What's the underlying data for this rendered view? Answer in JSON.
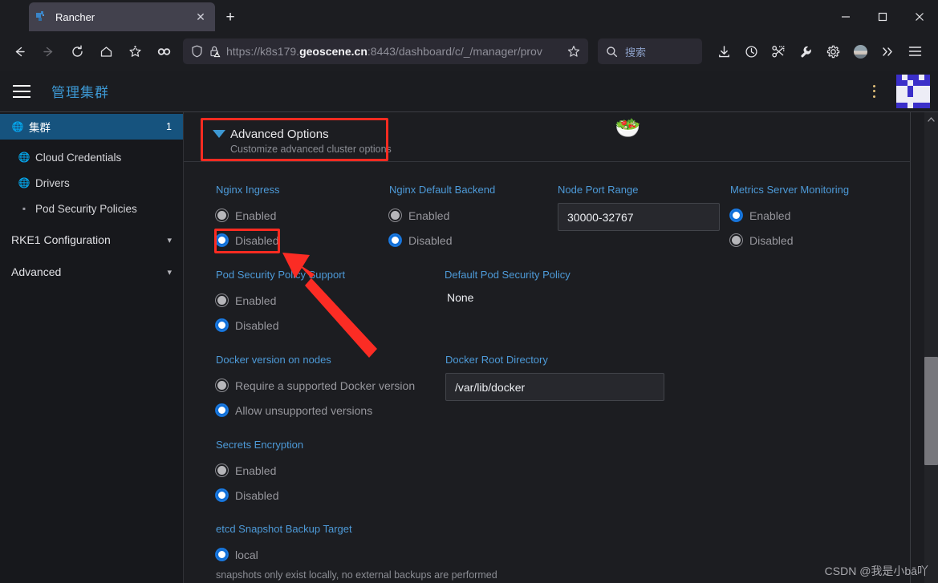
{
  "browser": {
    "tab": {
      "title": "Rancher",
      "favicon_icon": "rancher-logo-icon",
      "close_icon": "close-icon"
    },
    "newtab_icon": "plus-icon",
    "window_controls": {
      "minimize": "minimize-icon",
      "maximize": "maximize-icon",
      "close": "close-icon"
    },
    "nav": {
      "back_icon": "back-arrow-icon",
      "forward_icon": "forward-arrow-icon",
      "reload_icon": "reload-icon",
      "home_icon": "home-icon",
      "bookmark_icon": "bookmark-add-icon",
      "pocket_icon": "pocket-icon"
    },
    "url": {
      "shield_icon": "shield-icon",
      "lock_icon": "lock-warning-icon",
      "prefix": "https://k8s179.",
      "host_bold": "geoscene.cn",
      "suffix": ":8443/dashboard/c/_/manager/prov",
      "star_icon": "star-icon"
    },
    "search": {
      "icon": "search-icon",
      "placeholder": "搜索"
    },
    "toolbar": [
      {
        "name": "downloads-icon"
      },
      {
        "name": "history-icon"
      },
      {
        "name": "screenshot-icon"
      },
      {
        "name": "wrench-icon"
      },
      {
        "name": "gear-icon"
      },
      {
        "name": "account-avatar-icon"
      },
      {
        "name": "chevron-double-right-icon"
      },
      {
        "name": "app-menu-icon"
      }
    ]
  },
  "app_header": {
    "menu_icon": "hamburger-menu-icon",
    "title": "管理集群",
    "kebab_icon": "kebab-menu-icon",
    "avatar_icon": "user-avatar-identicon"
  },
  "sidebar": {
    "items": [
      {
        "label": "集群",
        "icon": "globe-icon",
        "count": "1",
        "active": true
      },
      {
        "label": "Cloud Credentials",
        "icon": "globe-icon",
        "count": "",
        "active": false
      },
      {
        "label": "Drivers",
        "icon": "globe-icon",
        "count": "",
        "active": false
      },
      {
        "label": "Pod Security Policies",
        "icon": "folder-icon",
        "count": "",
        "active": false
      }
    ],
    "groups": [
      {
        "label": "RKE1 Configuration",
        "chevron": "chevron-down-icon"
      },
      {
        "label": "Advanced",
        "chevron": "chevron-down-icon"
      }
    ]
  },
  "main": {
    "advanced_options": {
      "caret_icon": "caret-down-icon",
      "title": "Advanced Options",
      "subtitle": "Customize advanced cluster options"
    },
    "decoration_emoji": "🥗",
    "row1": {
      "nginx_ingress": {
        "label": "Nginx Ingress",
        "options": [
          {
            "label": "Enabled",
            "selected": false
          },
          {
            "label": "Disabled",
            "selected": true
          }
        ]
      },
      "nginx_default_backend": {
        "label": "Nginx Default Backend",
        "options": [
          {
            "label": "Enabled",
            "selected": false
          },
          {
            "label": "Disabled",
            "selected": true
          }
        ]
      },
      "node_port_range": {
        "label": "Node Port Range",
        "value": "30000-32767"
      },
      "metrics_server_monitoring": {
        "label": "Metrics Server Monitoring",
        "options": [
          {
            "label": "Enabled",
            "selected": true
          },
          {
            "label": "Disabled",
            "selected": false
          }
        ]
      }
    },
    "row2": {
      "psp_support": {
        "label": "Pod Security Policy Support",
        "options": [
          {
            "label": "Enabled",
            "selected": false
          },
          {
            "label": "Disabled",
            "selected": true
          }
        ]
      },
      "default_psp": {
        "label": "Default Pod Security Policy",
        "value": "None"
      }
    },
    "row3": {
      "docker_version": {
        "label": "Docker version on nodes",
        "options": [
          {
            "label": "Require a supported Docker version",
            "selected": false
          },
          {
            "label": "Allow unsupported versions",
            "selected": true
          }
        ]
      },
      "docker_root_dir": {
        "label": "Docker Root Directory",
        "value": "/var/lib/docker"
      }
    },
    "row4": {
      "secrets_encryption": {
        "label": "Secrets Encryption",
        "options": [
          {
            "label": "Enabled",
            "selected": false
          },
          {
            "label": "Disabled",
            "selected": true
          }
        ]
      }
    },
    "row5": {
      "etcd_snapshot": {
        "label": "etcd Snapshot Backup Target",
        "options": [
          {
            "label": "local",
            "selected": true
          }
        ],
        "hint": "snapshots only exist locally, no external backups are performed"
      }
    }
  },
  "scrollbar": {
    "up_arrow_icon": "chevron-up-icon",
    "thumb": "scrollbar-thumb"
  },
  "annotations": {
    "highlight_color": "#fe2b21",
    "arrow_icon": "red-pointer-arrow"
  },
  "watermark": "CSDN @我是小bā吖"
}
